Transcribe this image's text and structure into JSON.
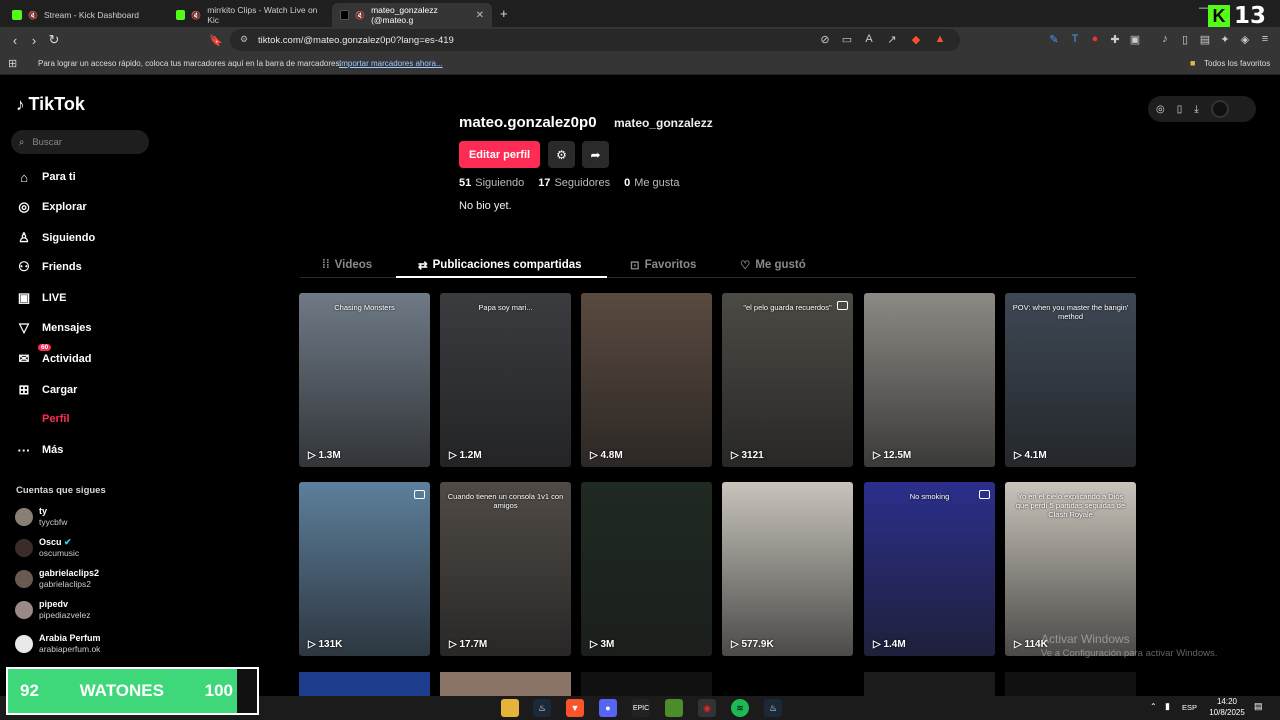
{
  "browser": {
    "tabs": [
      {
        "label": "Stream - Kick Dashboard",
        "active": false
      },
      {
        "label": "mirrkito Clips - Watch Live on Kic",
        "active": false
      },
      {
        "label": "mateo_gonzalezz (@mateo.g",
        "active": true
      }
    ],
    "new_tab": "+",
    "url": "tiktok.com/@mateo.gonzalez0p0?lang=es-419",
    "bookmarks_prompt": "Para lograr un acceso rápido, coloca tus marcadores aquí en la barra de marcadores.",
    "bookmarks_import": "Importar marcadores ahora...",
    "all_bookmarks": "Todos los favoritos"
  },
  "sidebar": {
    "logo": "TikTok",
    "search_placeholder": "Buscar",
    "items": [
      {
        "label": "Para ti",
        "icon": "home-icon"
      },
      {
        "label": "Explorar",
        "icon": "compass-icon"
      },
      {
        "label": "Siguiendo",
        "icon": "following-icon"
      },
      {
        "label": "Friends",
        "icon": "friends-icon"
      },
      {
        "label": "LIVE",
        "icon": "live-icon"
      },
      {
        "label": "Mensajes",
        "icon": "messages-icon"
      },
      {
        "label": "Actividad",
        "icon": "activity-icon",
        "badge": "60"
      },
      {
        "label": "Cargar",
        "icon": "upload-icon"
      },
      {
        "label": "Perfil",
        "icon": "profile-icon"
      },
      {
        "label": "Más",
        "icon": "more-icon"
      }
    ],
    "following_title": "Cuentas que sigues",
    "following": [
      {
        "name": "ty",
        "handle": "tyycbfw"
      },
      {
        "name": "Oscu",
        "handle": "oscumusic",
        "verified": true
      },
      {
        "name": "gabrielaclips2",
        "handle": "gabrielaclips2"
      },
      {
        "name": "pipedv",
        "handle": "pipediazvelez"
      },
      {
        "name": "Arabia Perfum",
        "handle": "arabiaperfum.ok"
      }
    ]
  },
  "profile": {
    "username": "mateo.gonzalez0p0",
    "nickname": "mateo_gonzalezz",
    "edit_button": "Editar perfil",
    "stats": [
      {
        "value": "51",
        "label": "Siguiendo"
      },
      {
        "value": "17",
        "label": "Seguidores"
      },
      {
        "value": "0",
        "label": "Me gusta"
      }
    ],
    "bio": "No bio yet."
  },
  "tabs": [
    {
      "label": "Videos",
      "active": false
    },
    {
      "label": "Publicaciones compartidas",
      "active": true
    },
    {
      "label": "Favoritos",
      "active": false
    },
    {
      "label": "Me gustó",
      "active": false
    }
  ],
  "videos": [
    {
      "views": "1.3M",
      "caption": "Chasing Monsters",
      "color": "#6f7a86"
    },
    {
      "views": "1.2M",
      "caption": "Papa soy mari...",
      "color": "#3a3c40"
    },
    {
      "views": "4.8M",
      "caption": "",
      "color": "#5a4a40"
    },
    {
      "views": "3121",
      "caption": "\"el pelo guarda recuerdos\"",
      "color": "#4c4a44",
      "pinned": true
    },
    {
      "views": "12.5M",
      "caption": "",
      "color": "#8c8a84"
    },
    {
      "views": "4.1M",
      "caption": "POV: when you master the bangin' method",
      "color": "#3e4854"
    },
    {
      "views": "131K",
      "caption": "",
      "color": "#5d7f9c",
      "pinned": true
    },
    {
      "views": "17.7M",
      "caption": "Cuando tienen un consola 1v1 con amigos",
      "color": "#4f4a46"
    },
    {
      "views": "3M",
      "caption": "",
      "color": "#1f2a22"
    },
    {
      "views": "577.9K",
      "caption": "",
      "color": "#c8c4bc"
    },
    {
      "views": "1.4M",
      "caption": "No smoking",
      "color": "#2b2f8c",
      "pinned": true
    },
    {
      "views": "114K",
      "caption": "Yo en el cielo explicando a Dios que perdí 5 partidas seguidas de Clash Royale",
      "color": "#c9c3ba"
    }
  ],
  "windows_watermark": {
    "line1": "Activar Windows",
    "line2": "Ve a Configuración para activar Windows."
  },
  "overlay": {
    "left_score": "92",
    "team": "WATONES",
    "right_score": "100",
    "counter": "13",
    "counter_color": "#53fc18"
  },
  "taskbar": {
    "time": "14:20",
    "date": "10/8/2025",
    "lang": "ESP"
  }
}
